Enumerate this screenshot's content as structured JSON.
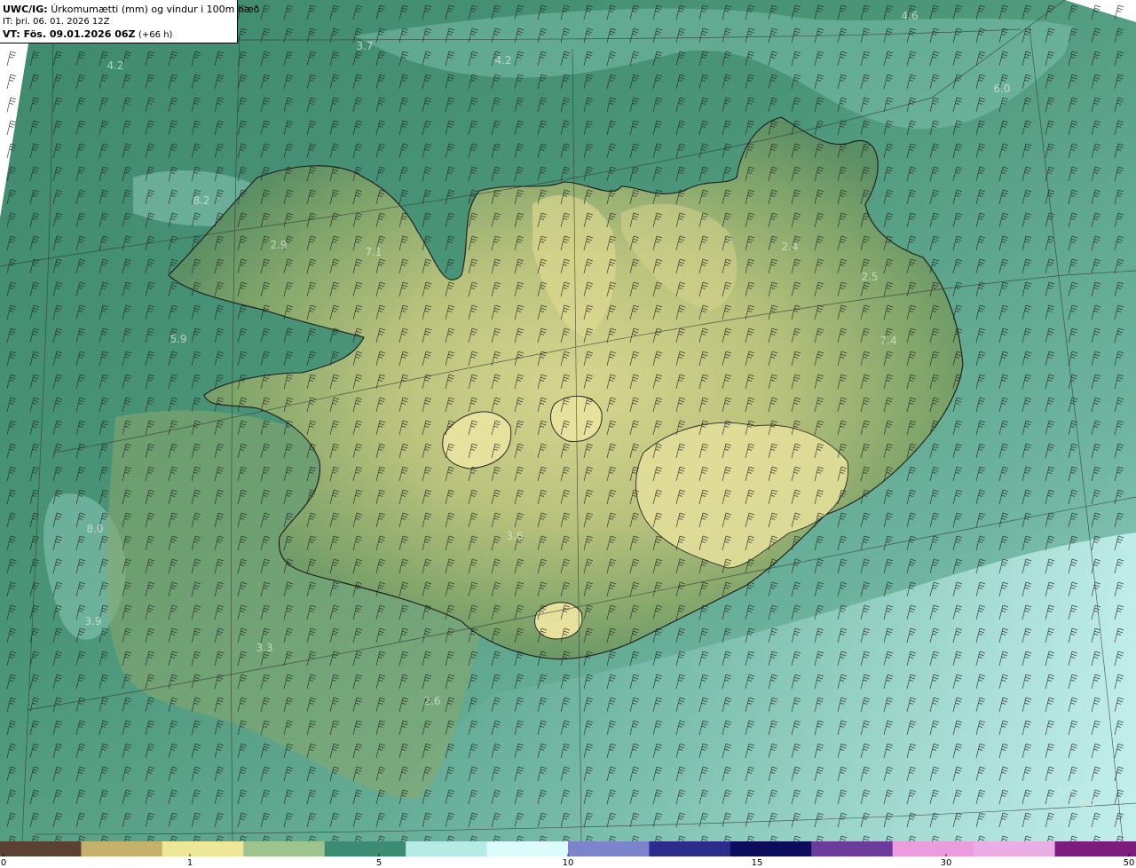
{
  "header": {
    "model": "UWC/IG:",
    "title": "Úrkomumætti (mm) og vindur i 100m hæð",
    "it_line": "IT: þri. 06. 01. 2026 12Z",
    "vt_label": "VT: Fös. 09.01.2026 06Z",
    "vt_lead": "(+66 h)"
  },
  "value_labels": [
    {
      "text": "4.6"
    },
    {
      "text": "3.7"
    },
    {
      "text": "4.2"
    },
    {
      "text": "4.2"
    },
    {
      "text": "6.0"
    },
    {
      "text": "8.2"
    },
    {
      "text": "2.9"
    },
    {
      "text": "7.1"
    },
    {
      "text": "2.4"
    },
    {
      "text": "2.5"
    },
    {
      "text": "7.4"
    },
    {
      "text": "5.9"
    },
    {
      "text": "8.0"
    },
    {
      "text": "3.6"
    },
    {
      "text": "3.9"
    },
    {
      "text": "3.3"
    },
    {
      "text": "2.6"
    },
    {
      "text": "4.9"
    },
    {
      "text": "8.1"
    }
  ],
  "colorbar": {
    "ticks": [
      "0",
      "1",
      "5",
      "10",
      "15",
      "30",
      "50"
    ],
    "colors": [
      "#5a4232",
      "#c4b26c",
      "#ece898",
      "#9cc48c",
      "#3c8c74",
      "#b4ece4",
      "#dcfcfc",
      "#7c84cc",
      "#2c2c8c",
      "#0c0c5c",
      "#6c3c9c",
      "#ec9cdc",
      "#ecace4",
      "#7c1c7c"
    ]
  },
  "wind_barb_color": "#222222",
  "coast_color": "#1a1a1a"
}
